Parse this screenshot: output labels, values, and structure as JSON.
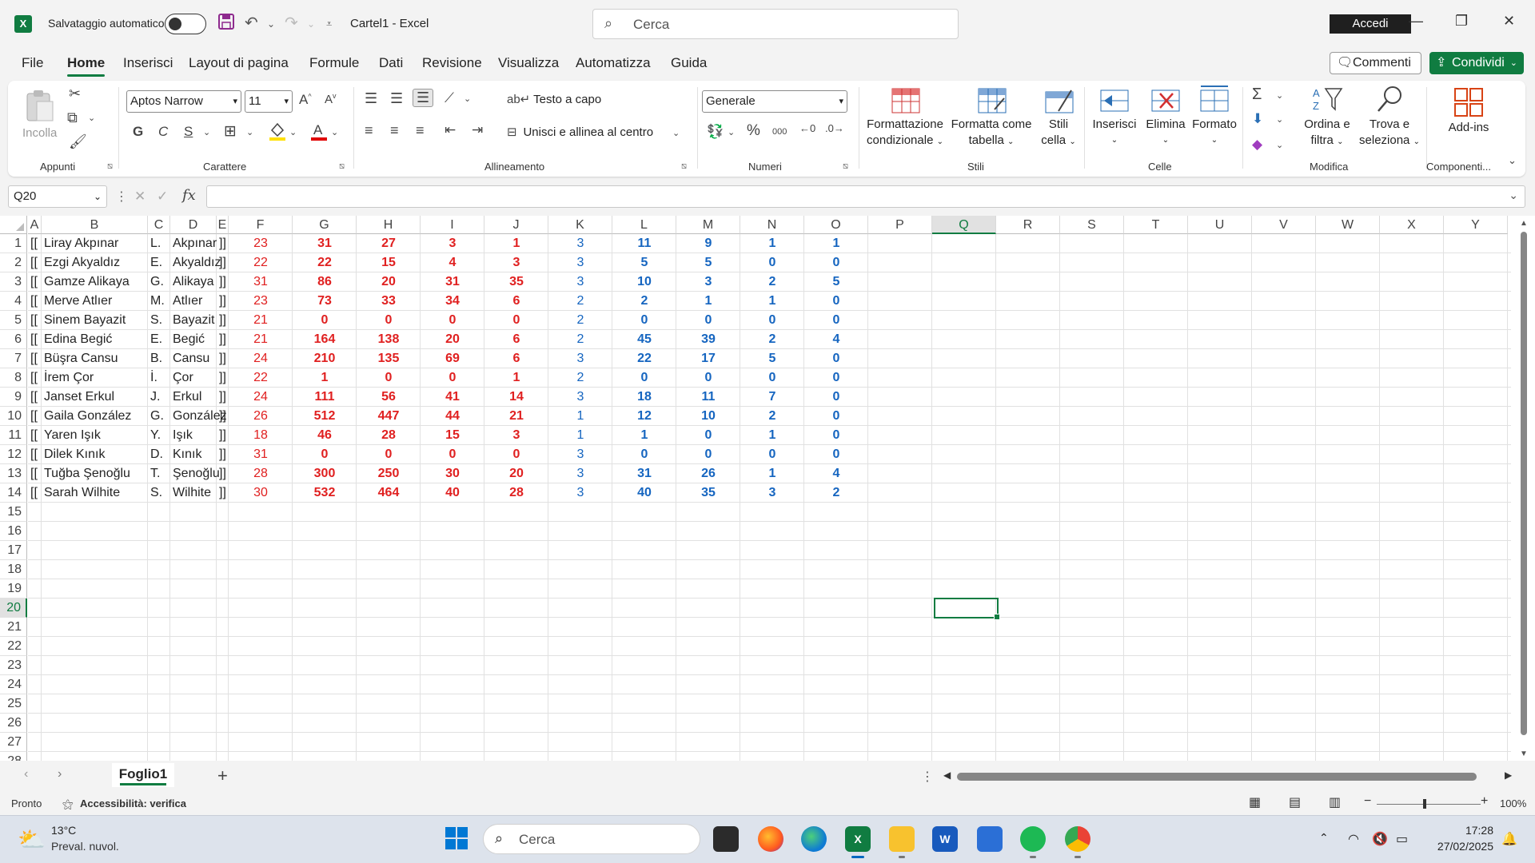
{
  "titlebar": {
    "autosave_label": "Salvataggio automatico",
    "doc_title": "Cartel1  -  Excel",
    "search_placeholder": "Cerca",
    "signin_label": "Accedi"
  },
  "menu": {
    "tabs": [
      "File",
      "Home",
      "Inserisci",
      "Layout di pagina",
      "Formule",
      "Dati",
      "Revisione",
      "Visualizza",
      "Automatizza",
      "Guida"
    ],
    "active": "Home",
    "commenti": "Commenti",
    "condividi": "Condividi"
  },
  "ribbon": {
    "appunti": {
      "label": "Appunti",
      "incolla": "Incolla"
    },
    "carattere": {
      "label": "Carattere",
      "font": "Aptos Narrow",
      "size": "11"
    },
    "allineamento": {
      "label": "Allineamento",
      "wrap": "Testo a capo",
      "merge": "Unisci e allinea al centro"
    },
    "numeri": {
      "label": "Numeri",
      "format": "Generale"
    },
    "stili": {
      "label": "Stili",
      "cond_1": "Formattazione",
      "cond_2": "condizionale",
      "table_1": "Formatta come",
      "table_2": "tabella",
      "cell_1": "Stili",
      "cell_2": "cella"
    },
    "celle": {
      "label": "Celle",
      "insert": "Inserisci",
      "delete": "Elimina",
      "format": "Formato"
    },
    "modifica": {
      "label": "Modifica",
      "sort_1": "Ordina e",
      "sort_2": "filtra",
      "find_1": "Trova e",
      "find_2": "seleziona"
    },
    "componenti": {
      "label": "Componenti...",
      "addins": "Add-ins"
    }
  },
  "formula_bar": {
    "namebox": "Q20",
    "fx": "fx",
    "content": ""
  },
  "grid": {
    "columns": [
      "A",
      "B",
      "C",
      "D",
      "E",
      "F",
      "G",
      "H",
      "I",
      "J",
      "K",
      "L",
      "M",
      "N",
      "O",
      "P",
      "Q",
      "R",
      "S",
      "T",
      "U",
      "V",
      "W",
      "X",
      "Y"
    ],
    "selected_column": "Q",
    "selected_row": 20,
    "row_numbers": [
      "1",
      "2",
      "3",
      "4",
      "5",
      "6",
      "7",
      "8",
      "9",
      "10",
      "11",
      "12",
      "13",
      "14",
      "15",
      "16",
      "17",
      "18",
      "19",
      "20",
      "21",
      "22",
      "23",
      "24",
      "25",
      "26",
      "27",
      "28"
    ],
    "rows": [
      [
        "[[",
        "Liray Akpınar",
        "L.",
        "Akpınar",
        "]]",
        "23",
        "31",
        "27",
        "3",
        "1",
        "3",
        "11",
        "9",
        "1",
        "1"
      ],
      [
        "[[",
        "Ezgi Akyaldız",
        "E.",
        "Akyaldız",
        "]]",
        "22",
        "22",
        "15",
        "4",
        "3",
        "3",
        "5",
        "5",
        "0",
        "0"
      ],
      [
        "[[",
        "Gamze Alikaya",
        "G.",
        "Alikaya",
        "]]",
        "31",
        "86",
        "20",
        "31",
        "35",
        "3",
        "10",
        "3",
        "2",
        "5"
      ],
      [
        "[[",
        "Merve Atlıer",
        "M.",
        "Atlıer",
        "]]",
        "23",
        "73",
        "33",
        "34",
        "6",
        "2",
        "2",
        "1",
        "1",
        "0"
      ],
      [
        "[[",
        "Sinem Bayazit",
        "S.",
        "Bayazit",
        "]]",
        "21",
        "0",
        "0",
        "0",
        "0",
        "2",
        "0",
        "0",
        "0",
        "0"
      ],
      [
        "[[",
        "Edina Begić",
        "E.",
        "Begić",
        "]]",
        "21",
        "164",
        "138",
        "20",
        "6",
        "2",
        "45",
        "39",
        "2",
        "4"
      ],
      [
        "[[",
        "Büşra Cansu",
        "B.",
        "Cansu",
        "]]",
        "24",
        "210",
        "135",
        "69",
        "6",
        "3",
        "22",
        "17",
        "5",
        "0"
      ],
      [
        "[[",
        "İrem Çor",
        "İ.",
        "Çor",
        "]]",
        "22",
        "1",
        "0",
        "0",
        "1",
        "2",
        "0",
        "0",
        "0",
        "0"
      ],
      [
        "[[",
        "Janset Erkul",
        "J.",
        "Erkul",
        "]]",
        "24",
        "111",
        "56",
        "41",
        "14",
        "3",
        "18",
        "11",
        "7",
        "0"
      ],
      [
        "[[",
        "Gaila González",
        "G.",
        "González",
        "]]",
        "26",
        "512",
        "447",
        "44",
        "21",
        "1",
        "12",
        "10",
        "2",
        "0"
      ],
      [
        "[[",
        "Yaren Işık",
        "Y.",
        "Işık",
        "]]",
        "18",
        "46",
        "28",
        "15",
        "3",
        "1",
        "1",
        "0",
        "1",
        "0"
      ],
      [
        "[[",
        "Dilek Kınık",
        "D.",
        "Kınık",
        "]]",
        "31",
        "0",
        "0",
        "0",
        "0",
        "3",
        "0",
        "0",
        "0",
        "0"
      ],
      [
        "[[",
        "Tuğba Şenoğlu",
        "T.",
        "Şenoğlu",
        "]]",
        "28",
        "300",
        "250",
        "30",
        "20",
        "3",
        "31",
        "26",
        "1",
        "4"
      ],
      [
        "[[",
        "Sarah Wilhite",
        "S.",
        "Wilhite",
        "]]",
        "30",
        "532",
        "464",
        "40",
        "28",
        "3",
        "40",
        "35",
        "3",
        "2"
      ]
    ],
    "colors": {
      "red": "#e02020",
      "blue": "#1565c0",
      "accent": "#107c41"
    }
  },
  "sheets": {
    "tabs": [
      "Foglio1"
    ],
    "add": "+"
  },
  "status": {
    "ready": "Pronto",
    "accessibility": "Accessibilità: verifica",
    "zoom": "100%"
  },
  "taskbar": {
    "weather_temp": "13°C",
    "weather_desc": "Preval. nuvol.",
    "search": "Cerca",
    "time": "17:28",
    "date": "27/02/2025"
  }
}
